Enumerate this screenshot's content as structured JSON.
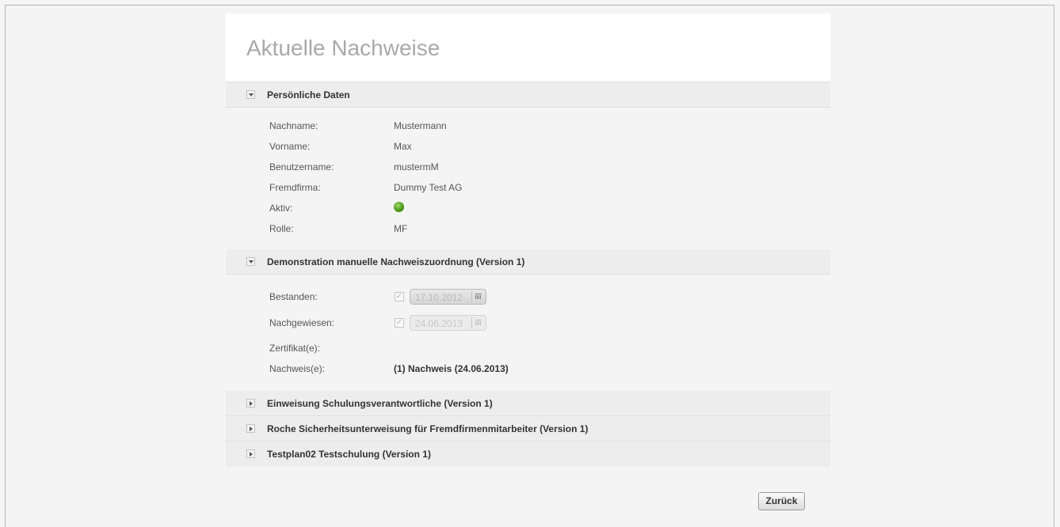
{
  "page_title": "Aktuelle Nachweise",
  "sections": {
    "personal": {
      "title": "Persönliche Daten",
      "expanded": true,
      "fields": {
        "lastname": {
          "label": "Nachname:",
          "value": "Mustermann"
        },
        "firstname": {
          "label": "Vorname:",
          "value": "Max"
        },
        "username": {
          "label": "Benutzername:",
          "value": "mustermM"
        },
        "company": {
          "label": "Fremdfirma:",
          "value": "Dummy Test AG"
        },
        "active": {
          "label": "Aktiv:",
          "status_color": "#4e9a1c"
        },
        "role": {
          "label": "Rolle:",
          "value": "MF"
        }
      }
    },
    "demo": {
      "title": "Demonstration manuelle Nachweiszuordnung (Version 1)",
      "expanded": true,
      "passed": {
        "label": "Bestanden:",
        "checked": true,
        "date": "17.10.2012"
      },
      "proven": {
        "label": "Nachgewiesen:",
        "checked": true,
        "date": "24.06.2013"
      },
      "certificates": {
        "label": "Zertifikat(e):"
      },
      "evidence": {
        "label": "Nachweis(e):",
        "value": "(1) Nachweis (24.06.2013)"
      }
    },
    "collapsed": [
      {
        "title": "Einweisung Schulungsverantwortliche (Version 1)"
      },
      {
        "title": "Roche Sicherheitsunterweisung für Fremdfirmenmitarbeiter (Version 1)"
      },
      {
        "title": "Testplan02 Testschulung (Version 1)"
      }
    ]
  },
  "back_button": "Zurück"
}
